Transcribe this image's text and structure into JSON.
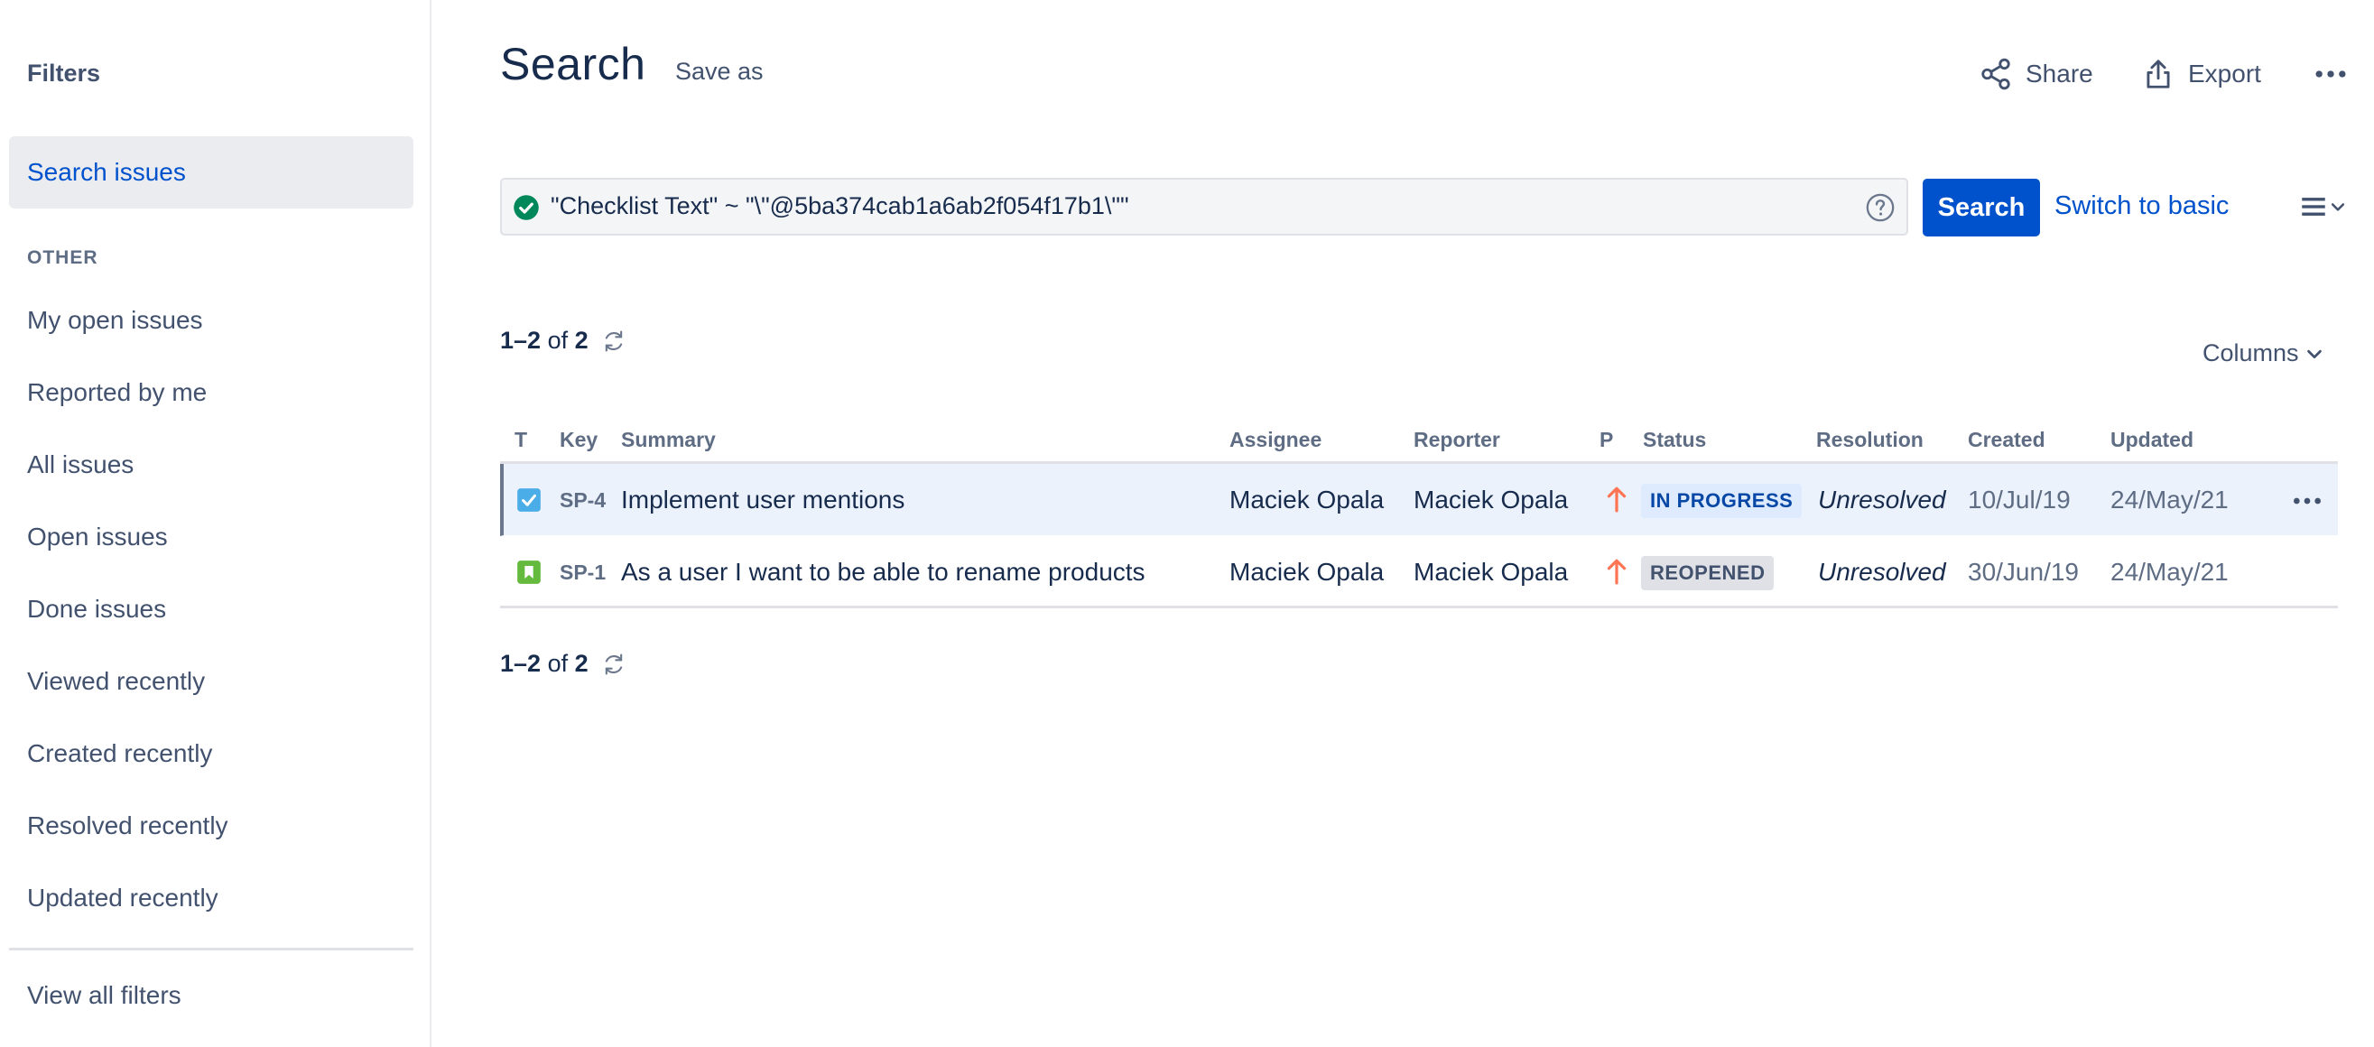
{
  "sidebar": {
    "title": "Filters",
    "active_item": "Search issues",
    "section_label": "OTHER",
    "items": [
      "My open issues",
      "Reported by me",
      "All issues",
      "Open issues",
      "Done issues",
      "Viewed recently",
      "Created recently",
      "Resolved recently",
      "Updated recently"
    ],
    "footer_link": "View all filters"
  },
  "header": {
    "title": "Search",
    "save_as": "Save as",
    "share": "Share",
    "export": "Export",
    "more_icon": "more-horizontal-icon"
  },
  "search": {
    "query": "\"Checklist Text\" ~ \"\\\"@5ba374cab1a6ab2f054f17b1\\\"\"",
    "valid_icon": "check-circle-icon",
    "help_icon": "question-circle-icon",
    "button": "Search",
    "switch_link": "Switch to basic",
    "view_icon": "list-view-icon"
  },
  "pagination": {
    "range": "1–2",
    "of_label": "of",
    "total": "2"
  },
  "columns_button": "Columns",
  "table": {
    "headers": {
      "type": "T",
      "key": "Key",
      "summary": "Summary",
      "assignee": "Assignee",
      "reporter": "Reporter",
      "priority": "P",
      "status": "Status",
      "resolution": "Resolution",
      "created": "Created",
      "updated": "Updated"
    },
    "rows": [
      {
        "type_icon": "task-icon",
        "key": "SP-4",
        "summary": "Implement user mentions",
        "assignee": "Maciek Opala",
        "reporter": "Maciek Opala",
        "priority_icon": "priority-high-icon",
        "status": "IN PROGRESS",
        "resolution": "Unresolved",
        "created": "10/Jul/19",
        "updated": "24/May/21"
      },
      {
        "type_icon": "story-icon",
        "key": "SP-1",
        "summary": "As a user I want to be able to rename products",
        "assignee": "Maciek Opala",
        "reporter": "Maciek Opala",
        "priority_icon": "priority-high-icon",
        "status": "REOPENED",
        "resolution": "Unresolved",
        "created": "30/Jun/19",
        "updated": "24/May/21"
      }
    ]
  },
  "colors": {
    "primary": "#0052cc",
    "text": "#172b4d",
    "subtle_text": "#42526e",
    "priority_high": "#ff7452",
    "task_icon": "#4bade8",
    "story_icon": "#63ba3c",
    "valid_check": "#36b37e"
  }
}
